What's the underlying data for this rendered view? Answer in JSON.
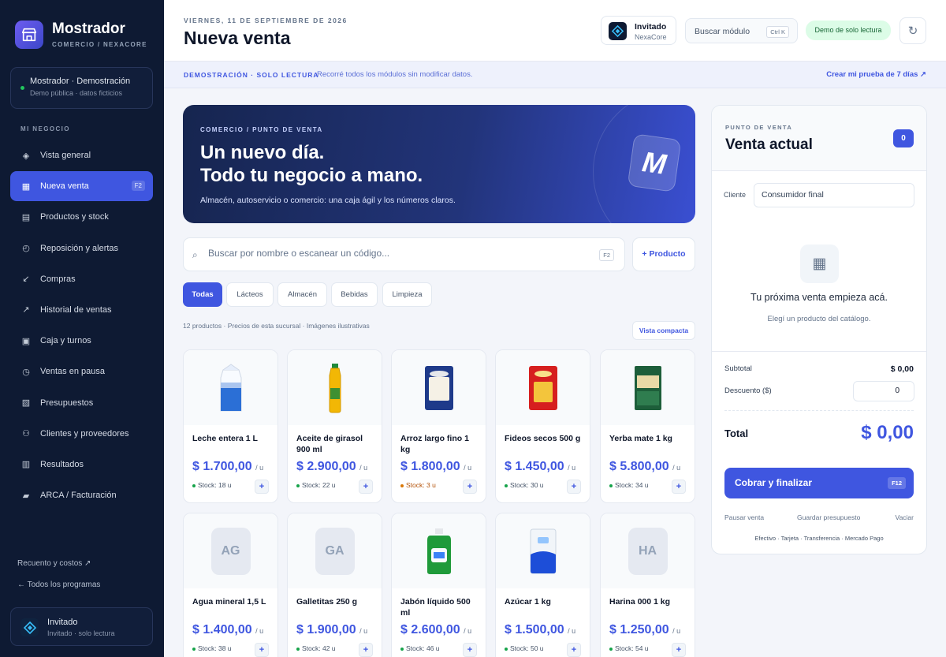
{
  "brand": {
    "name": "Mostrador",
    "subtitle": "COMERCIO / NEXACORE"
  },
  "workspace": {
    "title": "Mostrador · Demostración",
    "subtitle": "Demo pública · datos ficticios"
  },
  "sidebar": {
    "section_label": "MI NEGOCIO",
    "items": [
      {
        "label": "Vista general",
        "icon": "diamond-icon"
      },
      {
        "label": "Nueva venta",
        "icon": "grid-icon",
        "shortcut": "F2",
        "active": true
      },
      {
        "label": "Productos y stock",
        "icon": "list-icon"
      },
      {
        "label": "Reposición y alertas",
        "icon": "clock-icon"
      },
      {
        "label": "Compras",
        "icon": "arrow-down-left-icon"
      },
      {
        "label": "Historial de ventas",
        "icon": "arrow-up-right-icon"
      },
      {
        "label": "Caja y turnos",
        "icon": "register-icon"
      },
      {
        "label": "Ventas en pausa",
        "icon": "pause-clock-icon"
      },
      {
        "label": "Presupuestos",
        "icon": "document-icon"
      },
      {
        "label": "Clientes y proveedores",
        "icon": "people-icon"
      },
      {
        "label": "Resultados",
        "icon": "table-icon"
      },
      {
        "label": "ARCA / Facturación",
        "icon": "invoice-icon"
      }
    ],
    "links": {
      "costs": "Recuento y costos ↗",
      "all_programs": "← Todos los programas"
    },
    "user": {
      "name": "Invitado",
      "subtitle": "Invitado · solo lectura"
    }
  },
  "header": {
    "date": "VIERNES, 11 DE SEPTIEMBRE DE 2026",
    "title": "Nueva venta",
    "user_name": "Invitado",
    "user_org": "NexaCore",
    "search_label": "Buscar módulo",
    "search_shortcut": "Ctrl K",
    "badge": "Demo de solo lectura"
  },
  "strip": {
    "tag": "DEMOSTRACIÓN · SOLO LECTURA",
    "message": "Recorré todos los módulos sin modificar datos.",
    "link": "Crear mi prueba de 7 días ↗"
  },
  "hero": {
    "eyebrow": "COMERCIO / PUNTO DE VENTA",
    "line1": "Un nuevo día.",
    "line2": "Todo tu negocio a mano.",
    "description": "Almacén, autoservicio o comercio: una caja ágil y los números claros.",
    "mark": "M"
  },
  "search": {
    "placeholder": "Buscar por nombre o escanear un código...",
    "shortcut": "F2",
    "add_product": "+ Producto"
  },
  "categories": [
    "Todas",
    "Lácteos",
    "Almacén",
    "Bebidas",
    "Limpieza"
  ],
  "catalog": {
    "meta": "12 productos · Precios de esta sucursal · Imágenes ilustrativas",
    "compact_view": "Vista compacta"
  },
  "products": [
    {
      "name": "Leche entera 1 L",
      "price": "$ 1.700,00",
      "unit": "/ u",
      "stock": "Stock: 18 u"
    },
    {
      "name": "Aceite de girasol 900 ml",
      "price": "$ 2.900,00",
      "unit": "/ u",
      "stock": "Stock: 22 u"
    },
    {
      "name": "Arroz largo fino 1 kg",
      "price": "$ 1.800,00",
      "unit": "/ u",
      "stock": "Stock: 3 u",
      "low": true
    },
    {
      "name": "Fideos secos 500 g",
      "price": "$ 1.450,00",
      "unit": "/ u",
      "stock": "Stock: 30 u"
    },
    {
      "name": "Yerba mate 1 kg",
      "price": "$ 5.800,00",
      "unit": "/ u",
      "stock": "Stock: 34 u"
    },
    {
      "name": "Agua mineral 1,5 L",
      "price": "$ 1.400,00",
      "unit": "/ u",
      "stock": "Stock: 38 u",
      "initials": "AG"
    },
    {
      "name": "Galletitas 250 g",
      "price": "$ 1.900,00",
      "unit": "/ u",
      "stock": "Stock: 42 u",
      "initials": "GA"
    },
    {
      "name": "Jabón líquido 500 ml",
      "price": "$ 2.600,00",
      "unit": "/ u",
      "stock": "Stock: 46 u"
    },
    {
      "name": "Azúcar 1 kg",
      "price": "$ 1.500,00",
      "unit": "/ u",
      "stock": "Stock: 50 u"
    },
    {
      "name": "Harina 000 1 kg",
      "price": "$ 1.250,00",
      "unit": "/ u",
      "stock": "Stock: 54 u",
      "initials": "HA"
    }
  ],
  "cart": {
    "eyebrow": "PUNTO DE VENTA",
    "title": "Venta actual",
    "count": "0",
    "client_label": "Cliente",
    "client_value": "Consumidor final",
    "empty_title": "Tu próxima venta empieza acá.",
    "empty_subtitle": "Elegí un producto del catálogo.",
    "subtotal_label": "Subtotal",
    "subtotal_value": "$ 0,00",
    "discount_label": "Descuento ($)",
    "discount_value": "0",
    "total_label": "Total",
    "total_value": "$ 0,00",
    "pay_button": "Cobrar y finalizar",
    "pay_shortcut": "F12",
    "pause": "Pausar venta",
    "save_quote": "Guardar presupuesto",
    "clear": "Vaciar",
    "payment_methods": "Efectivo · Tarjeta · Transferencia · Mercado Pago"
  },
  "colors": {
    "accent": "#3f56e0",
    "sidebar": "#0e1a33",
    "success": "#16a34a",
    "warning": "#d97706"
  }
}
